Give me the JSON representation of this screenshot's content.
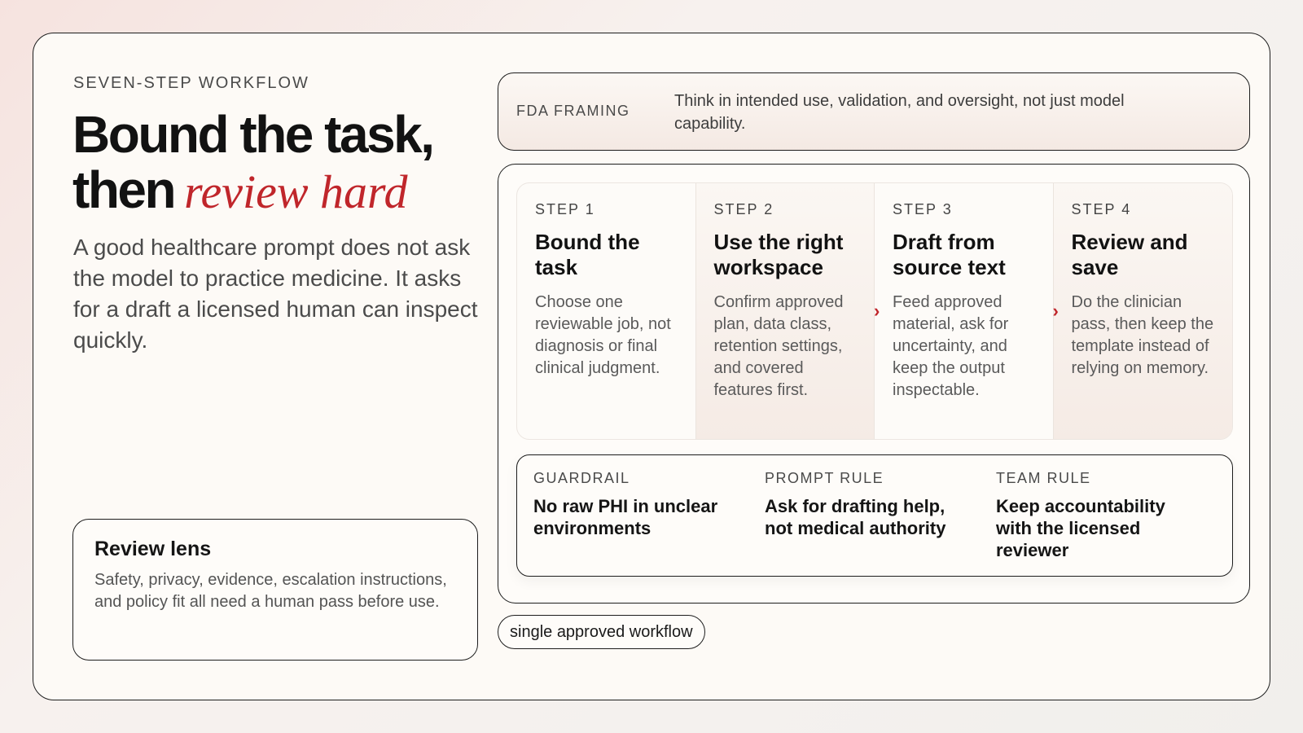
{
  "header": {
    "eyebrow": "SEVEN-STEP WORKFLOW",
    "title_main": "Bound the task, then",
    "title_accent": "review hard",
    "lede": "A good healthcare prompt does not ask the model to practice medicine. It asks for a draft a licensed human can inspect quickly."
  },
  "review_lens": {
    "title": "Review lens",
    "text": "Safety, privacy, evidence, escalation instructions, and policy fit all need a human pass before use."
  },
  "fda": {
    "label": "FDA FRAMING",
    "text": "Think in intended use, validation, and oversight, not just model capability."
  },
  "steps": [
    {
      "num": "STEP 1",
      "title": "Bound the task",
      "text": "Choose one reviewable job, not diagnosis or final clinical judgment."
    },
    {
      "num": "STEP 2",
      "title": "Use the right workspace",
      "text": "Confirm approved plan, data class, retention settings, and covered features first."
    },
    {
      "num": "STEP 3",
      "title": "Draft from source text",
      "text": "Feed approved material, ask for uncertainty, and keep the output inspectable."
    },
    {
      "num": "STEP 4",
      "title": "Review and save",
      "text": "Do the clinician pass, then keep the template instead of relying on memory."
    }
  ],
  "chevron": "›",
  "rules": [
    {
      "label": "GUARDRAIL",
      "text": "No raw PHI in unclear environments"
    },
    {
      "label": "PROMPT RULE",
      "text": "Ask for drafting help, not medical authority"
    },
    {
      "label": "TEAM RULE",
      "text": "Keep accountability with the licensed reviewer"
    }
  ],
  "pill": "single approved workflow",
  "colors": {
    "accent": "#c0262b",
    "card": "#fdfaf6",
    "border": "#1d1d1d"
  }
}
